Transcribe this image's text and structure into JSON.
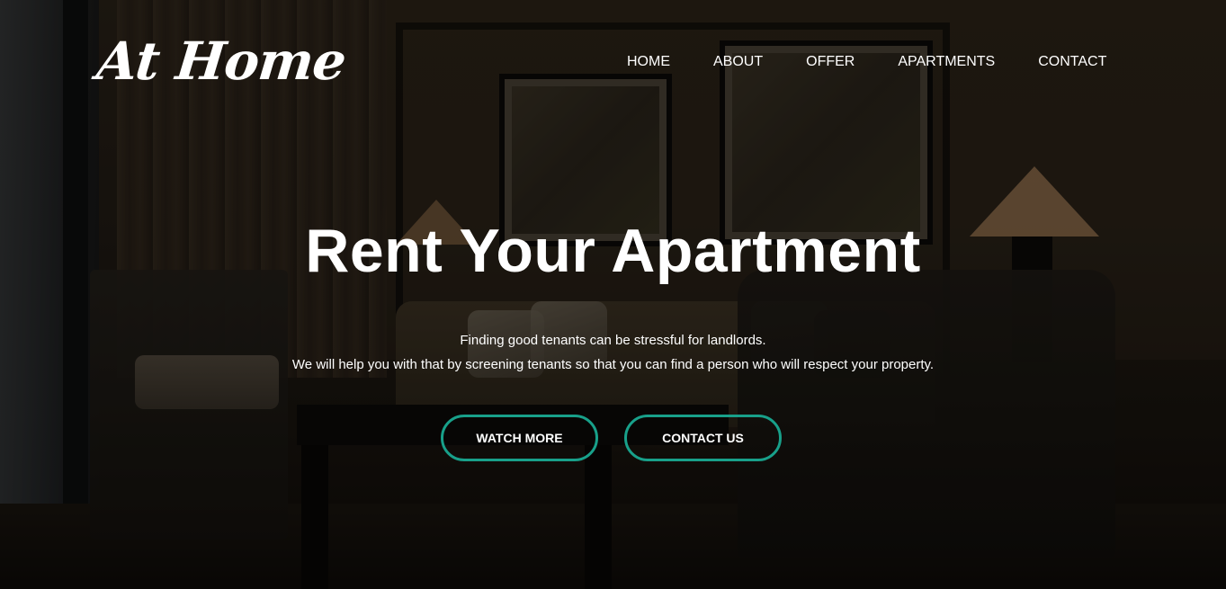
{
  "header": {
    "logo": "At Home",
    "nav": [
      {
        "label": "HOME"
      },
      {
        "label": "ABOUT"
      },
      {
        "label": "OFFER"
      },
      {
        "label": "APARTMENTS"
      },
      {
        "label": "CONTACT"
      }
    ]
  },
  "hero": {
    "headline": "Rent Your Apartment",
    "subtext_line1": "Finding good tenants can be stressful for landlords.",
    "subtext_line2": "We will help you with that by screening tenants so that you can find a person who will respect your property.",
    "buttons": {
      "watch_more": "WATCH MORE",
      "contact_us": "CONTACT US"
    },
    "accent_color": "#18a08a"
  }
}
